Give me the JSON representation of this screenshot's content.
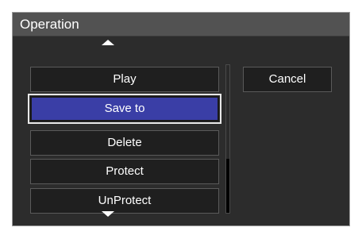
{
  "dialog": {
    "title": "Operation"
  },
  "menu": {
    "items": [
      {
        "label": "Play",
        "selected": false
      },
      {
        "label": "Save to",
        "selected": true
      },
      {
        "label": "Delete",
        "selected": false
      },
      {
        "label": "Protect",
        "selected": false
      },
      {
        "label": "UnProtect",
        "selected": false
      }
    ],
    "scroll_up_icon": "triangle-up-icon",
    "scroll_down_icon": "triangle-down-icon"
  },
  "actions": {
    "cancel_label": "Cancel"
  },
  "colors": {
    "dialog_bg": "#2c2c2c",
    "title_bar_bg": "#525252",
    "button_bg": "#1f1f1f",
    "selected_bg": "#3a3ea6",
    "text": "#ffffff"
  }
}
